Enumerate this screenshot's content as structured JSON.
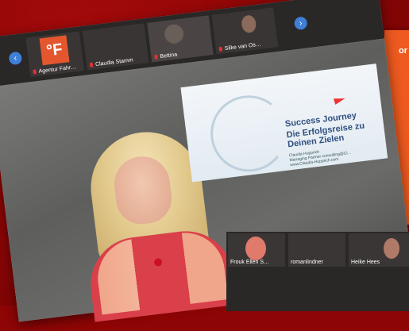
{
  "poster": {
    "text": "or"
  },
  "strip": {
    "participants": [
      "Agentur Fahr…",
      "Claudia Stamm",
      "Bettina",
      "Silke van Os…"
    ],
    "logo_letter": "°F",
    "prev_icon": "chevron-left-icon",
    "next_icon": "chevron-right-icon"
  },
  "slide": {
    "title_line1": "Success Journey",
    "title_line2": "Die Erfolgsreise zu Deinen Zielen",
    "sub_line1": "Claudia Hupprich",
    "sub_line2": "Managing Partner consulting@Cl…",
    "sub_line3": "www.Claudia-Hupprich.com"
  },
  "gallery": {
    "participants": [
      "Frouk Ellen S…",
      "romanlindner",
      "Heike Hees"
    ]
  },
  "colors": {
    "background": "#8e0505",
    "poster": "#ee5a1f",
    "nav": "#3e7fd8"
  }
}
